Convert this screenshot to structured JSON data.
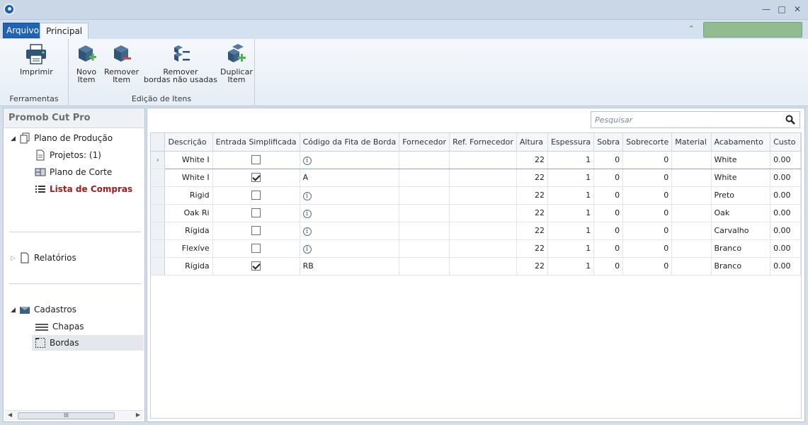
{
  "tabs": {
    "arquivo": "Arquivo",
    "principal": "Principal"
  },
  "ribbon": {
    "groups": {
      "ferramentas": "Ferramentas",
      "edicao": "Edição de Itens"
    },
    "buttons": {
      "imprimir": "Imprimir",
      "novo_item_1": "Novo",
      "novo_item_2": "Item",
      "remover_item_1": "Remover",
      "remover_item_2": "Item",
      "remover_bordas_1": "Remover",
      "remover_bordas_2": "bordas não usadas",
      "duplicar_item_1": "Duplicar",
      "duplicar_item_2": "Item"
    }
  },
  "sidebar": {
    "title": "Promob Cut Pro",
    "plano_producao": "Plano de Produção",
    "projetos": "Projetos: (1)",
    "plano_corte": "Plano de Corte",
    "lista_compras": "Lista de Compras",
    "relatorios": "Relatórios",
    "cadastros": "Cadastros",
    "chapas": "Chapas",
    "bordas": "Bordas",
    "scroll_thumb": "III"
  },
  "search": {
    "placeholder": "Pesquisar"
  },
  "table": {
    "columns": [
      "Descrição",
      "Entrada Simplificada",
      "Código da Fita de Borda",
      "Fornecedor",
      "Ref. Fornecedor",
      "Altura",
      "Espessura",
      "Sobra",
      "Sobrecorte",
      "Material",
      "Acabamento",
      "Custo"
    ],
    "rows": [
      {
        "descricao": "White I",
        "simplificada": false,
        "codigo": "",
        "altura": "22",
        "espessura": "1",
        "sobra": "0",
        "sobrecorte": "0",
        "acabamento": "White",
        "custo": "0.00"
      },
      {
        "descricao": "White I",
        "simplificada": true,
        "codigo": "A",
        "altura": "22",
        "espessura": "1",
        "sobra": "0",
        "sobrecorte": "0",
        "acabamento": "White",
        "custo": "0.00"
      },
      {
        "descricao": "Rigid",
        "simplificada": false,
        "codigo": "",
        "altura": "22",
        "espessura": "1",
        "sobra": "0",
        "sobrecorte": "0",
        "acabamento": "Preto",
        "custo": "0.00"
      },
      {
        "descricao": "Oak Ri",
        "simplificada": false,
        "codigo": "",
        "altura": "22",
        "espessura": "1",
        "sobra": "0",
        "sobrecorte": "0",
        "acabamento": "Oak",
        "custo": "0.00"
      },
      {
        "descricao": "Rígida",
        "simplificada": false,
        "codigo": "",
        "altura": "22",
        "espessura": "1",
        "sobra": "0",
        "sobrecorte": "0",
        "acabamento": "Carvalho",
        "custo": "0.00"
      },
      {
        "descricao": "Flexíve",
        "simplificada": false,
        "codigo": "",
        "altura": "22",
        "espessura": "1",
        "sobra": "0",
        "sobrecorte": "0",
        "acabamento": "Branco",
        "custo": "0.00"
      },
      {
        "descricao": "Rígida",
        "simplificada": true,
        "codigo": "RB",
        "altura": "22",
        "espessura": "1",
        "sobra": "0",
        "sobrecorte": "0",
        "acabamento": "Branco",
        "custo": "0.00"
      }
    ]
  },
  "colors": {
    "accent": "#1f63b4",
    "active_tree": "#a31b1b",
    "status_box": "#90bc90"
  }
}
